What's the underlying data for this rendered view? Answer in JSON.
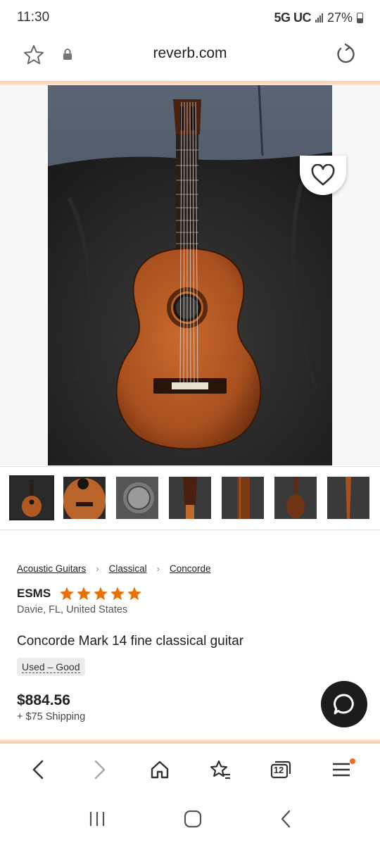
{
  "status_bar": {
    "time": "11:30",
    "network": "5G UC",
    "battery": "27%"
  },
  "browser": {
    "url": "reverb.com"
  },
  "listing": {
    "breadcrumbs": [
      "Acoustic Guitars",
      "Classical",
      "Concorde"
    ],
    "seller_name": "ESMS",
    "seller_rating_stars": 5,
    "location": "Davie, FL, United States",
    "title": "Concorde Mark 14 fine classical guitar",
    "condition": "Used – Good",
    "price": "$884.56",
    "shipping": "+ $75 Shipping"
  },
  "toolbar": {
    "tab_count": "12"
  },
  "colors": {
    "accent": "#f26a1b",
    "star": "#e8710a",
    "chat_button": "#1c1c1c"
  }
}
